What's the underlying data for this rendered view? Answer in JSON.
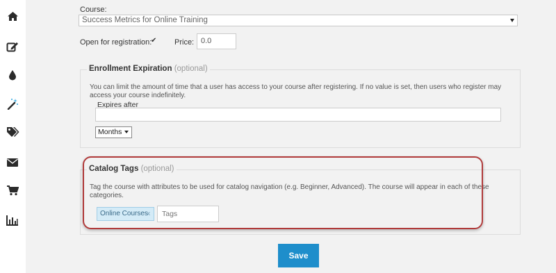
{
  "sidebar": {
    "items": [
      {
        "icon": "home-icon"
      },
      {
        "icon": "edit-icon"
      },
      {
        "icon": "drop-icon"
      },
      {
        "icon": "magic-wand-icon"
      },
      {
        "icon": "tags-icon"
      },
      {
        "icon": "envelope-icon"
      },
      {
        "icon": "cart-icon"
      },
      {
        "icon": "bar-chart-icon"
      }
    ]
  },
  "form": {
    "course_label": "Course:",
    "course_value": "Success Metrics for Online Training",
    "open_label": "Open for registration:",
    "open_checked": true,
    "price_label": "Price:",
    "price_value": "0.0"
  },
  "enrollment": {
    "title": "Enrollment Expiration",
    "optional": "(optional)",
    "description": "You can limit the amount of time that a user has access to your course after registering. If no value is set, then users who register may access your course indefinitely.",
    "expires_label": "Expires after",
    "expires_value": "",
    "unit_value": "Months"
  },
  "catalog": {
    "title": "Catalog Tags",
    "optional": "(optional)",
    "description": "Tag the course with attributes to be used for catalog navigation (e.g. Beginner, Advanced). The course will appear in each of these categories.",
    "tags": [
      {
        "label": "Online Courses",
        "remove": "x"
      }
    ],
    "tags_placeholder": "Tags"
  },
  "actions": {
    "save_label": "Save"
  },
  "colors": {
    "accent": "#1e8ecb",
    "highlight": "#b03a3a",
    "tag_bg": "#d4ebf7"
  }
}
